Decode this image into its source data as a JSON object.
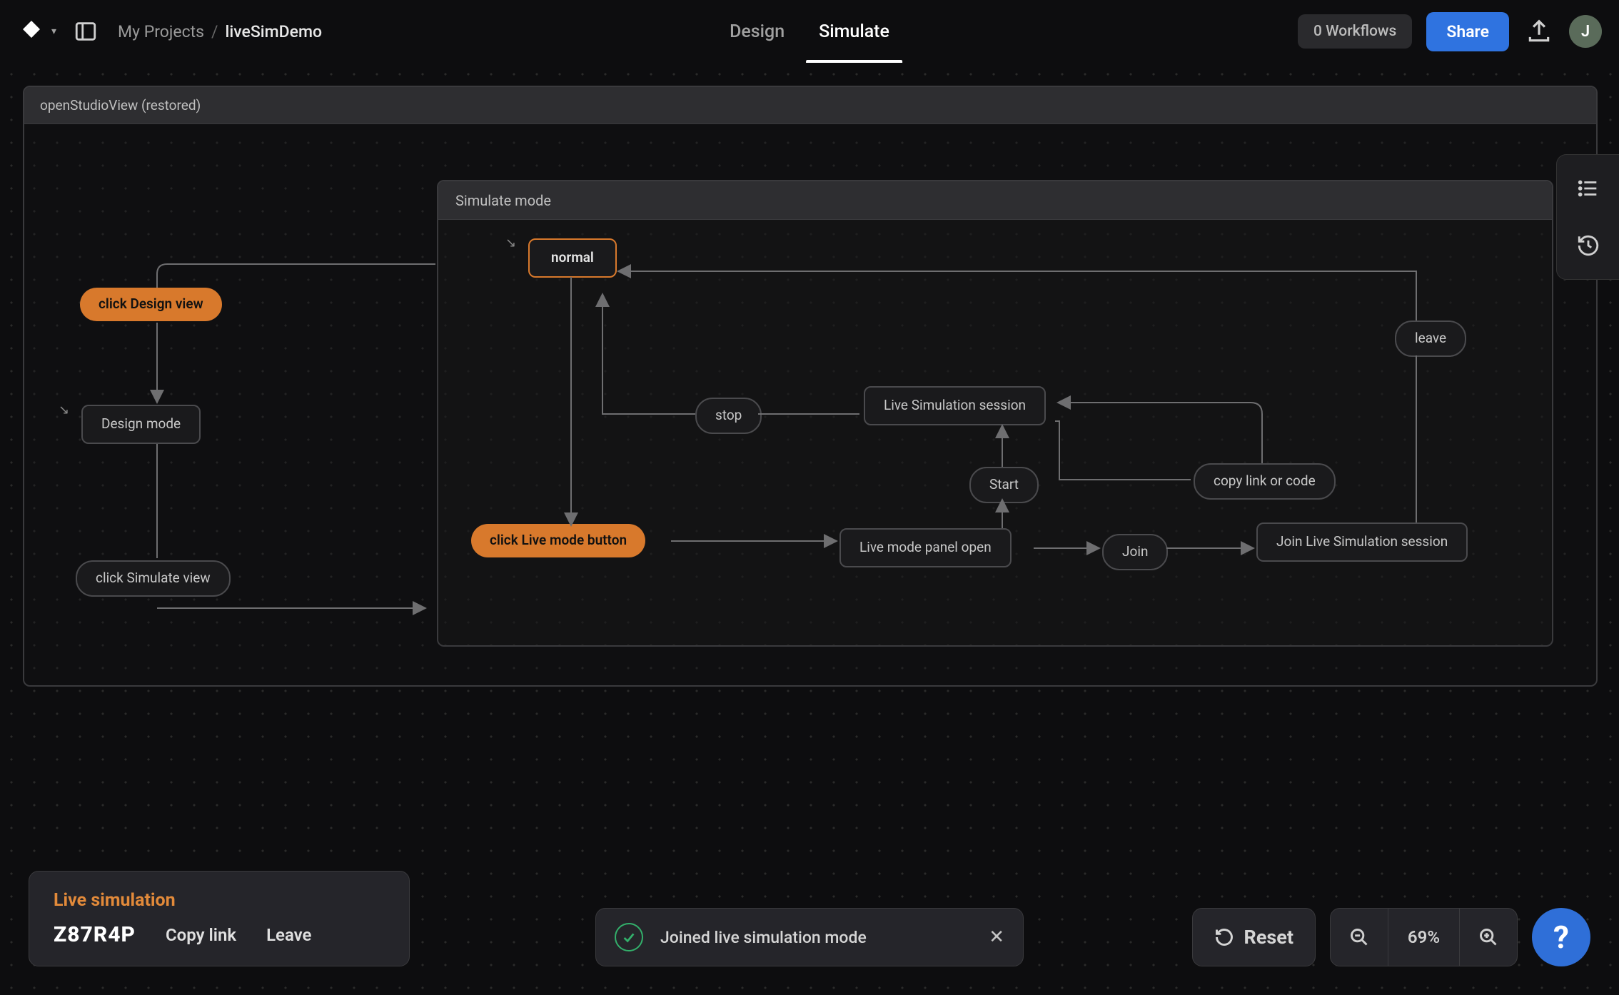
{
  "header": {
    "breadcrumb_root": "My Projects",
    "breadcrumb_current": "liveSimDemo",
    "tab_design": "Design",
    "tab_simulate": "Simulate",
    "workflows": "0 Workflows",
    "share": "Share",
    "avatar_initial": "J"
  },
  "canvas": {
    "outer_title": "openStudioView (restored)",
    "inner_title": "Simulate mode",
    "nodes": {
      "click_design_view": "click Design view",
      "design_mode": "Design mode",
      "click_simulate_view": "click Simulate view",
      "normal": "normal",
      "stop": "stop",
      "live_sim_session": "Live Simulation session",
      "start": "Start",
      "click_live_mode_btn": "click Live mode button",
      "live_mode_panel_open": "Live mode panel open",
      "join": "Join",
      "join_live_sim_session": "Join Live Simulation session",
      "copy_link_or_code": "copy link or code",
      "leave": "leave"
    }
  },
  "live_panel": {
    "title": "Live simulation",
    "code": "Z87R4P",
    "copy_link": "Copy link",
    "leave": "Leave"
  },
  "toast": {
    "message": "Joined live simulation mode"
  },
  "bottom_right": {
    "reset": "Reset",
    "zoom": "69%"
  }
}
